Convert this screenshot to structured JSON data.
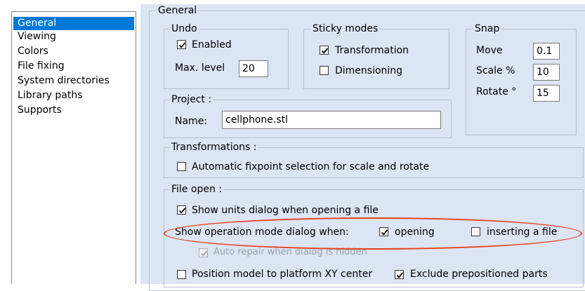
{
  "categories": [
    "General",
    "Viewing",
    "Colors",
    "File fixing",
    "System directories",
    "Library paths",
    "Supports"
  ],
  "selected_category": "General",
  "general": {
    "title": "General",
    "undo": {
      "title": "Undo",
      "enabled_label": "Enabled",
      "enabled": true,
      "max_level_label": "Max. level",
      "max_level": "20"
    },
    "sticky": {
      "title": "Sticky modes",
      "transformation_label": "Transformation",
      "transformation": true,
      "dimensioning_label": "Dimensioning",
      "dimensioning": false
    },
    "snap": {
      "title": "Snap",
      "move_label": "Move",
      "move": "0.1",
      "scale_label": "Scale %",
      "scale": "10",
      "rotate_label": "Rotate °",
      "rotate": "15"
    },
    "project": {
      "title": "Project :",
      "name_label": "Name:",
      "name": "cellphone.stl"
    },
    "transformations": {
      "title": "Transformations :",
      "auto_fixpoint_label": "Automatic fixpoint selection for scale and rotate",
      "auto_fixpoint": false
    },
    "file_open": {
      "title": "File open :",
      "show_units_label": "Show units dialog when opening a file",
      "show_units": true,
      "op_mode_label": "Show operation mode dialog when:",
      "opening_label": "opening",
      "opening": true,
      "inserting_label": "inserting a file",
      "inserting": false,
      "auto_repair_label": "Auto repair when dialog is hidden",
      "auto_repair": true,
      "position_label": "Position model to platform XY center",
      "position": false,
      "exclude_label": "Exclude prepositioned parts",
      "exclude": true
    }
  },
  "colors": {
    "highlight": "#e8401c",
    "selection": "#0078d7",
    "panel": "#dbe5f3"
  }
}
